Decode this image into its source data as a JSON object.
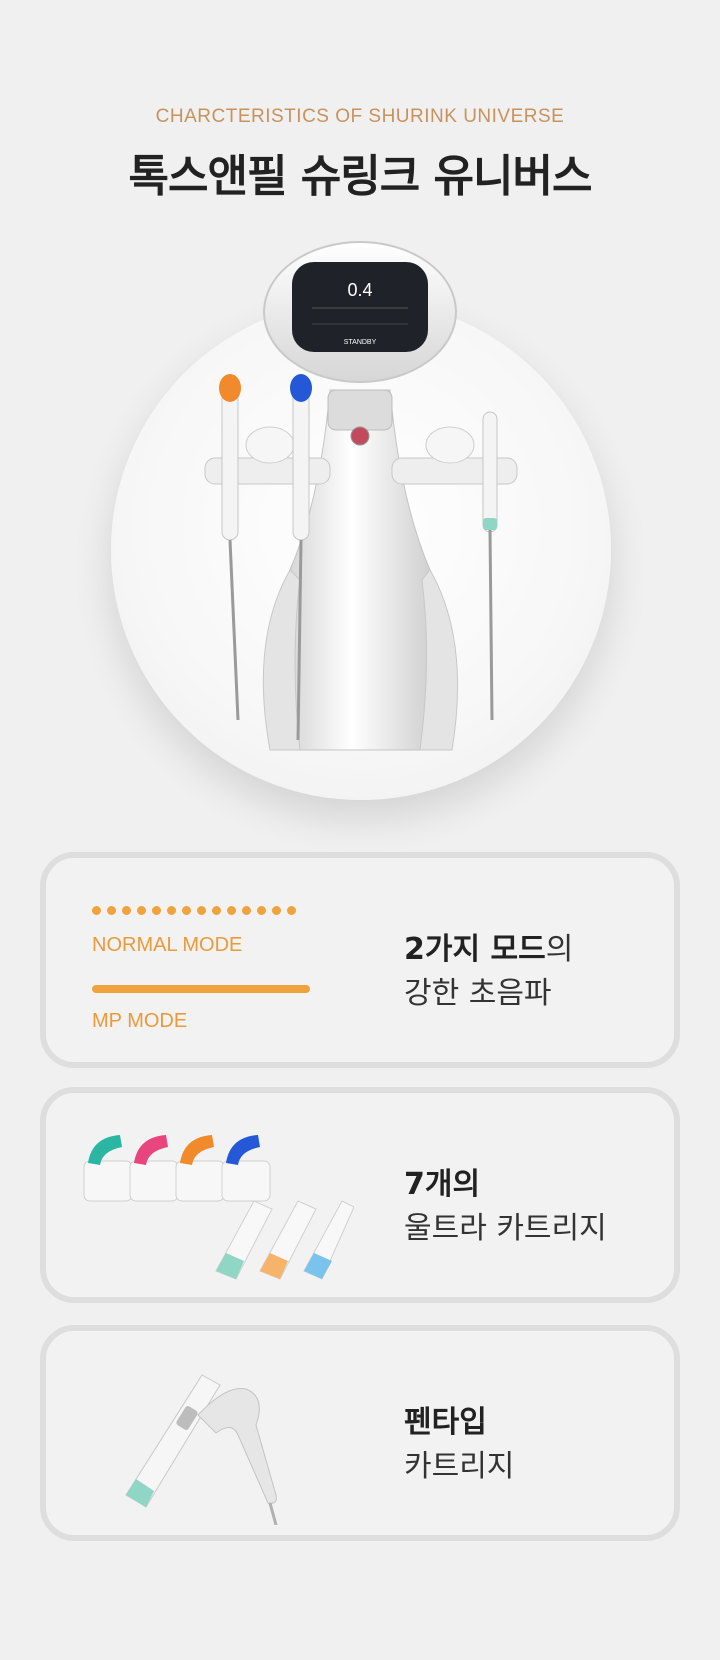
{
  "header": {
    "subtitle": "CHARCTERISTICS OF SHURINK UNIVERSE",
    "title": "톡스앤필 슈링크 유니버스"
  },
  "device_screen": {
    "value": "0.4",
    "status": "STANDBY"
  },
  "cards": [
    {
      "modes": {
        "normal_label": "NORMAL MODE",
        "mp_label": "MP MODE"
      },
      "text_bold": "2가지 모드",
      "text_suffix": "의",
      "text_line2": "강한 초음파"
    },
    {
      "text_bold": "7개의",
      "text_line2": "울트라 카트리지"
    },
    {
      "text_bold": "펜타입",
      "text_line2": "카트리지"
    }
  ],
  "colors": {
    "accent_orange": "#f0a23c",
    "subtitle_gold": "#c9925c",
    "teal": "#2bb5a3",
    "magenta": "#e8457e",
    "orange": "#f08a2a",
    "blue": "#2458d6",
    "light_orange": "#f6b46a",
    "light_blue": "#79c3ec",
    "mint": "#8fd6c4"
  }
}
